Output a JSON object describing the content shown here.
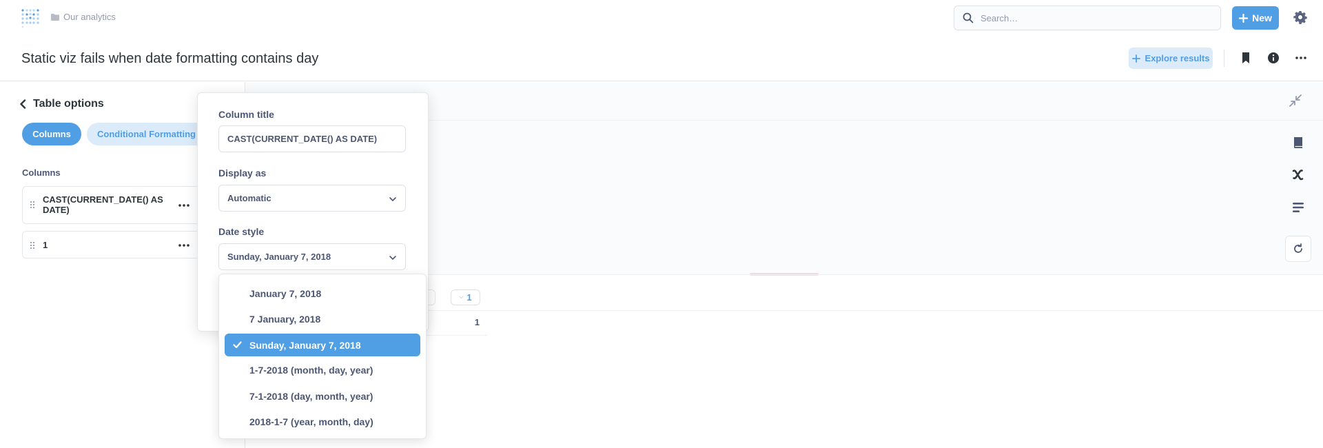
{
  "nav": {
    "breadcrumb": "Our analytics",
    "search_placeholder": "Search…",
    "new_label": "New"
  },
  "header": {
    "title": "Static viz fails when date formatting contains day",
    "explore_label": "Explore results"
  },
  "sidebar": {
    "back_label": "Table options",
    "tabs": [
      {
        "label": "Columns",
        "active": true
      },
      {
        "label": "Conditional Formatting",
        "active": false
      }
    ],
    "columns_header": "Columns",
    "columns": [
      {
        "label": "CAST(CURRENT_DATE() AS DATE)"
      },
      {
        "label": "1"
      }
    ]
  },
  "popover": {
    "column_title_label": "Column title",
    "column_title_value": "CAST(CURRENT_DATE() AS DATE)",
    "display_as_label": "Display as",
    "display_as_value": "Automatic",
    "date_style_label": "Date style",
    "date_style_value": "Sunday, January 7, 2018"
  },
  "date_style_options": [
    {
      "label": "January 7, 2018",
      "selected": false
    },
    {
      "label": "7 January, 2018",
      "selected": false
    },
    {
      "label": "Sunday, January 7, 2018",
      "selected": true
    },
    {
      "label": "1-7-2018 (month, day, year)",
      "selected": false
    },
    {
      "label": "7-1-2018 (day, month, year)",
      "selected": false
    },
    {
      "label": "2018-1-7 (year, month, day)",
      "selected": false
    }
  ],
  "table": {
    "header_value": "1",
    "cell_value": "1"
  },
  "colors": {
    "brand": "#509ee3",
    "brand_light": "#dcebf9",
    "text_dark": "#2e353b",
    "text_medium": "#4c5773",
    "text_light": "#949aab",
    "border": "#e4e7ea"
  },
  "icons": [
    "metabase-logo-icon",
    "folder-icon",
    "search-icon",
    "plus-icon",
    "gear-icon",
    "bookmark-icon",
    "info-icon",
    "ellipsis-icon",
    "chevron-left-icon",
    "grip-icon",
    "collapse-icon",
    "book-icon",
    "variable-icon",
    "snippet-icon",
    "refresh-icon",
    "chevron-down-icon",
    "check-icon"
  ]
}
